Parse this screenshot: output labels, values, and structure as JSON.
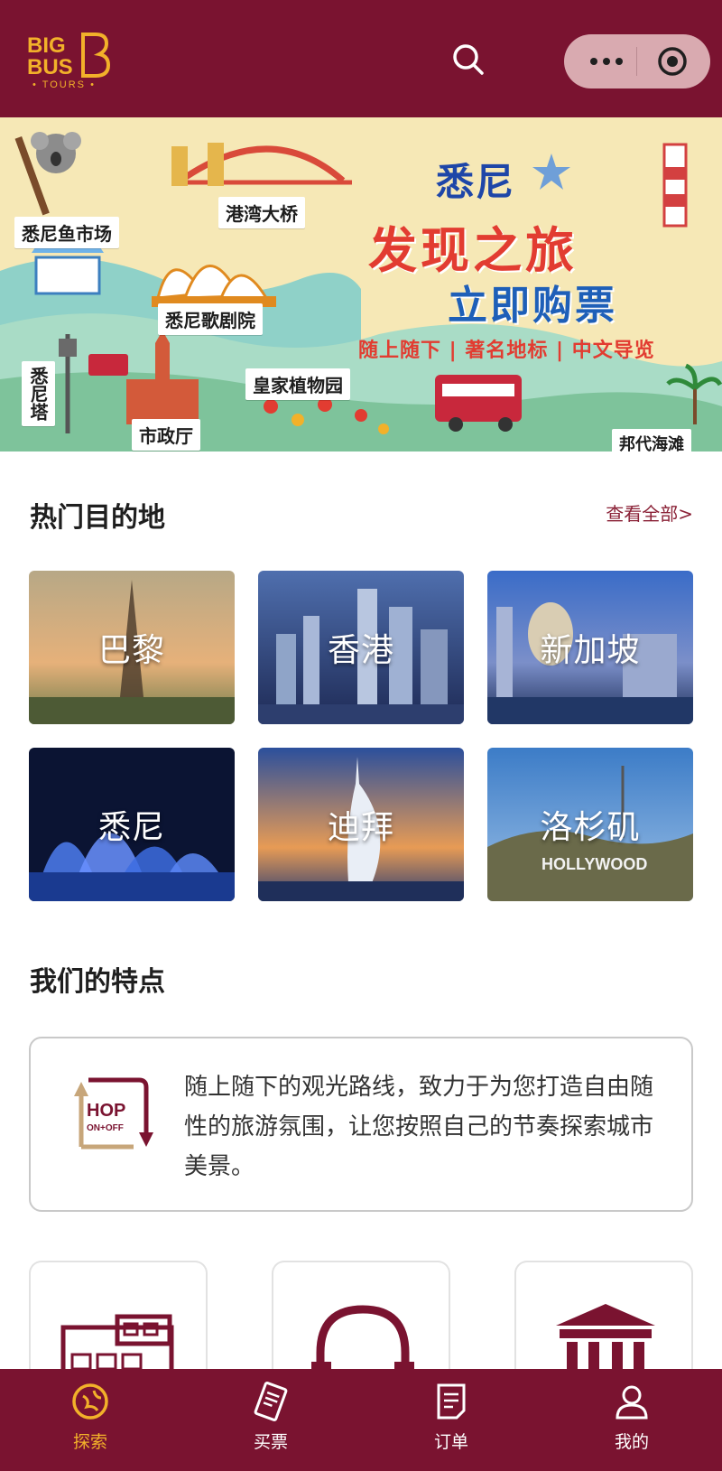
{
  "header": {
    "logo_text": "BIG BUS TOURS"
  },
  "banner": {
    "title_city": "悉尼",
    "title_main": "发现之旅",
    "title_cta": "立即购票",
    "subtitle": "随上随下 | 著名地标 | 中文导览",
    "pins": [
      "悉尼鱼市场",
      "港湾大桥",
      "悉尼歌剧院",
      "悉尼塔",
      "市政厅",
      "皇家植物园",
      "邦代海滩"
    ]
  },
  "destinations": {
    "title": "热门目的地",
    "see_all": "查看全部>",
    "items": [
      {
        "label": "巴黎"
      },
      {
        "label": "香港"
      },
      {
        "label": "新加坡"
      },
      {
        "label": "悉尼"
      },
      {
        "label": "迪拜"
      },
      {
        "label": "洛杉矶"
      }
    ]
  },
  "features": {
    "title": "我们的特点",
    "hop_line1": "HOP",
    "hop_line2": "ON+OFF",
    "description": "随上随下的观光路线，致力于为您打造自由随性的旅游氛围，让您按照自己的节奏探索城市美景。"
  },
  "tabbar": {
    "items": [
      {
        "label": "探索",
        "icon": "explore-icon",
        "active": true
      },
      {
        "label": "买票",
        "icon": "ticket-icon",
        "active": false
      },
      {
        "label": "订单",
        "icon": "order-icon",
        "active": false
      },
      {
        "label": "我的",
        "icon": "profile-icon",
        "active": false
      }
    ]
  },
  "colors": {
    "brand": "#7a1330",
    "accent": "#f2b12a",
    "see_all": "#8a2136"
  }
}
